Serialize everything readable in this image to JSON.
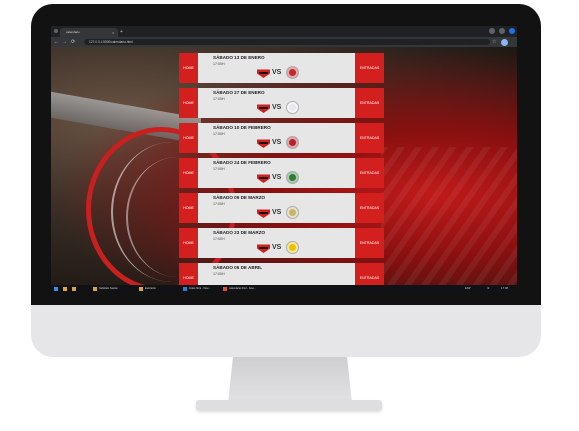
{
  "browser": {
    "tab_title": "calendario",
    "tab_close": "×",
    "new_tab": "+",
    "back": "←",
    "forward": "→",
    "reload": "⟳",
    "url": "127.0.0.1:5500/calendario.html",
    "bookmark_icon": "star-icon"
  },
  "schedule": {
    "home_label": "HOME",
    "tickets_label": "ENTRADAS",
    "vs_label": "VS",
    "games": [
      {
        "date": "SÁBADO 13 DE ENERO",
        "time": "17:00H",
        "away_color": "#c0282e"
      },
      {
        "date": "SÁBADO 27 DE ENERO",
        "time": "17:00H",
        "away_color": "#e8e8f2"
      },
      {
        "date": "SÁBADO 10 DE FEBRERO",
        "time": "17:00H",
        "away_color": "#b3242a"
      },
      {
        "date": "SÁBADO 24 DE FEBRERO",
        "time": "17:00H",
        "away_color": "#2e7d32"
      },
      {
        "date": "SÁBADO 09 DE MARZO",
        "time": "17:00H",
        "away_color": "#c9b36a"
      },
      {
        "date": "SÁBADO 23 DE MARZO",
        "time": "17:00H",
        "away_color": "#e8c400"
      },
      {
        "date": "SÁBADO 06 DE ABRIL",
        "time": "17:00H",
        "away_color": ""
      }
    ]
  },
  "taskbar": {
    "items": [
      "Subtítulo Sesión",
      "Escritorio",
      "Index.html - Visu...",
      "calendario.html - Goo..."
    ],
    "tray_text": "ESP",
    "clock": "17:08"
  },
  "colors": {
    "accent": "#d41f1f",
    "row_bg": "#e6e6e6"
  }
}
